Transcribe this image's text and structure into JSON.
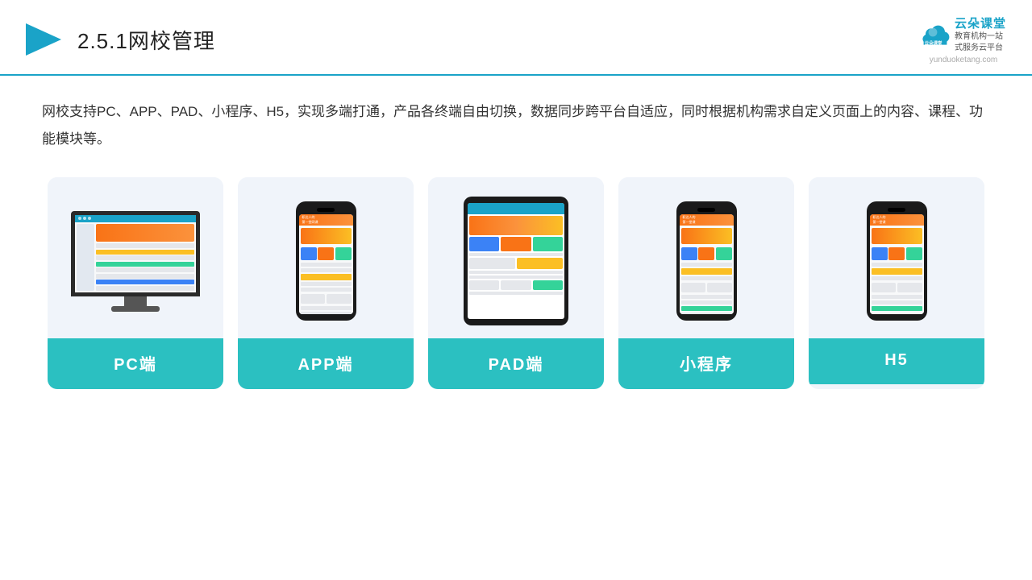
{
  "header": {
    "title_prefix": "2.5.1",
    "title_main": "网校管理",
    "logo_text": "云朵课堂",
    "logo_url": "yunduoketang.com",
    "logo_slogan": "教育机构一站\n式服务云平台"
  },
  "description": {
    "text": "网校支持PC、APP、PAD、小程序、H5，实现多端打通，产品各终端自由切换，数据同步跨平台自适应，同时根据机构需求自定义页面上的内容、课程、功能模块等。"
  },
  "cards": [
    {
      "id": "pc",
      "label": "PC端",
      "device": "monitor"
    },
    {
      "id": "app",
      "label": "APP端",
      "device": "phone"
    },
    {
      "id": "pad",
      "label": "PAD端",
      "device": "tablet"
    },
    {
      "id": "miniapp",
      "label": "小程序",
      "device": "phone"
    },
    {
      "id": "h5",
      "label": "H5",
      "device": "phone"
    }
  ],
  "colors": {
    "teal": "#2bc0c1",
    "blue": "#1aa3c8",
    "accent_orange": "#f97316",
    "accent_yellow": "#fbbf24",
    "accent_green": "#34d399"
  }
}
